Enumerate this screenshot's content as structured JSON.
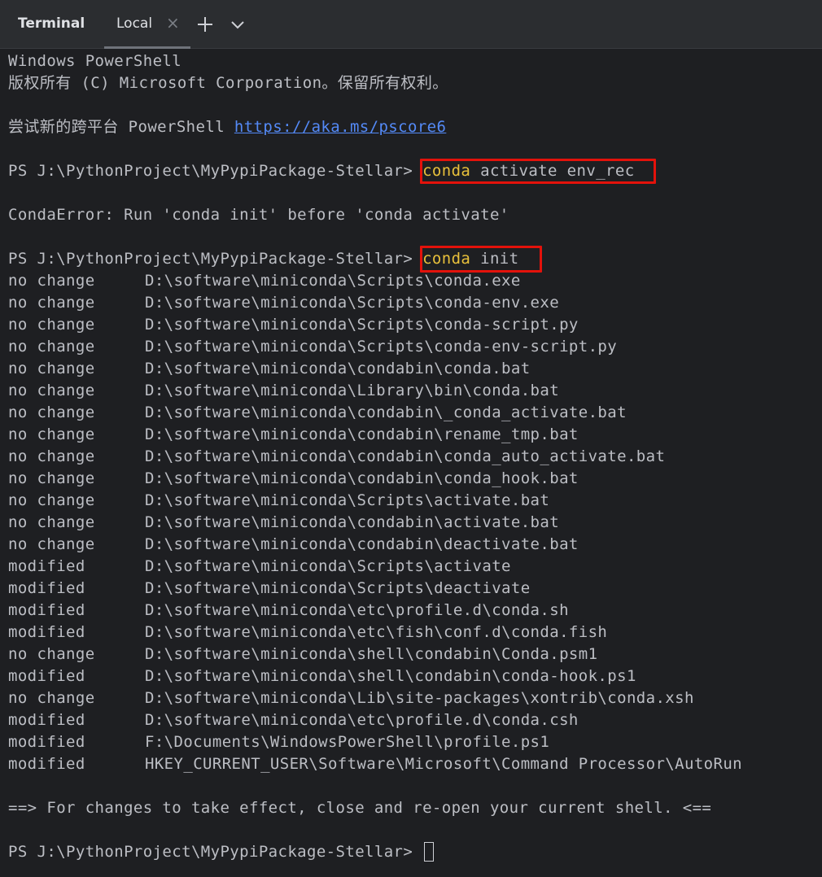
{
  "toolbar": {
    "title": "Terminal",
    "tab_label": "Local",
    "close_icon": "×",
    "add_icon": "plus-icon",
    "dropdown_icon": "chevron-down-icon"
  },
  "terminal": {
    "header_lines": [
      "Windows PowerShell",
      "版权所有 (C) Microsoft Corporation。保留所有权利。"
    ],
    "try_prefix": "尝试新的跨平台 PowerShell ",
    "try_link": "https://aka.ms/pscore6",
    "prompt": "PS J:\\PythonProject\\MyPypiPackage-Stellar> ",
    "cmd1": {
      "keyword": "conda",
      "rest": " activate env_rec"
    },
    "error_line": "CondaError: Run 'conda init' before 'conda activate'",
    "cmd2": {
      "keyword": "conda",
      "rest": " init"
    },
    "init_results": [
      {
        "status": "no change",
        "path": "D:\\software\\miniconda\\Scripts\\conda.exe"
      },
      {
        "status": "no change",
        "path": "D:\\software\\miniconda\\Scripts\\conda-env.exe"
      },
      {
        "status": "no change",
        "path": "D:\\software\\miniconda\\Scripts\\conda-script.py"
      },
      {
        "status": "no change",
        "path": "D:\\software\\miniconda\\Scripts\\conda-env-script.py"
      },
      {
        "status": "no change",
        "path": "D:\\software\\miniconda\\condabin\\conda.bat"
      },
      {
        "status": "no change",
        "path": "D:\\software\\miniconda\\Library\\bin\\conda.bat"
      },
      {
        "status": "no change",
        "path": "D:\\software\\miniconda\\condabin\\_conda_activate.bat"
      },
      {
        "status": "no change",
        "path": "D:\\software\\miniconda\\condabin\\rename_tmp.bat"
      },
      {
        "status": "no change",
        "path": "D:\\software\\miniconda\\condabin\\conda_auto_activate.bat"
      },
      {
        "status": "no change",
        "path": "D:\\software\\miniconda\\condabin\\conda_hook.bat"
      },
      {
        "status": "no change",
        "path": "D:\\software\\miniconda\\Scripts\\activate.bat"
      },
      {
        "status": "no change",
        "path": "D:\\software\\miniconda\\condabin\\activate.bat"
      },
      {
        "status": "no change",
        "path": "D:\\software\\miniconda\\condabin\\deactivate.bat"
      },
      {
        "status": "modified",
        "path": "D:\\software\\miniconda\\Scripts\\activate"
      },
      {
        "status": "modified",
        "path": "D:\\software\\miniconda\\Scripts\\deactivate"
      },
      {
        "status": "modified",
        "path": "D:\\software\\miniconda\\etc\\profile.d\\conda.sh"
      },
      {
        "status": "modified",
        "path": "D:\\software\\miniconda\\etc\\fish\\conf.d\\conda.fish"
      },
      {
        "status": "no change",
        "path": "D:\\software\\miniconda\\shell\\condabin\\Conda.psm1"
      },
      {
        "status": "modified",
        "path": "D:\\software\\miniconda\\shell\\condabin\\conda-hook.ps1"
      },
      {
        "status": "no change",
        "path": "D:\\software\\miniconda\\Lib\\site-packages\\xontrib\\conda.xsh"
      },
      {
        "status": "modified",
        "path": "D:\\software\\miniconda\\etc\\profile.d\\conda.csh"
      },
      {
        "status": "modified",
        "path": "F:\\Documents\\WindowsPowerShell\\profile.ps1"
      },
      {
        "status": "modified",
        "path": "HKEY_CURRENT_USER\\Software\\Microsoft\\Command Processor\\AutoRun"
      }
    ],
    "footer_message": "==> For changes to take effect, close and re-open your current shell. <=="
  },
  "colors": {
    "background": "#1e1f22",
    "text": "#bcbec4",
    "command_highlight": "#e8c03b",
    "link": "#548af7",
    "annotation_box": "#e3120b"
  }
}
